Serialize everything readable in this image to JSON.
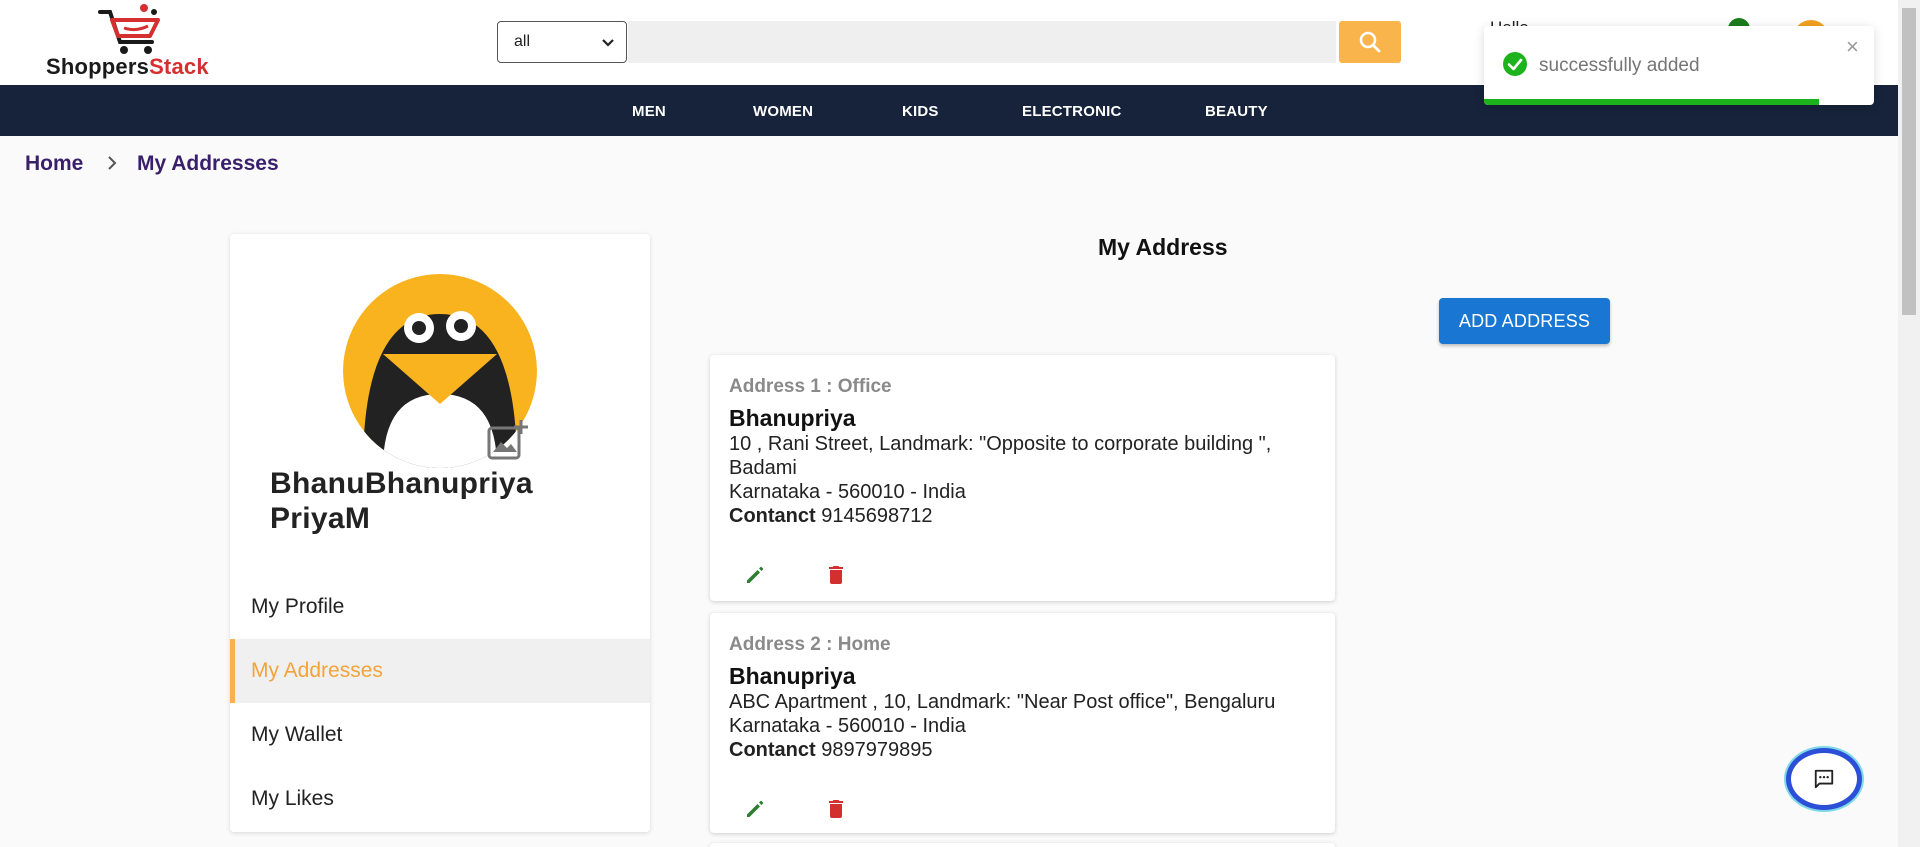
{
  "header": {
    "logo": {
      "part1": "Shoppers",
      "part2": "Stack"
    },
    "search": {
      "category_selected": "all",
      "placeholder": ""
    },
    "greeting": "Hello"
  },
  "nav": {
    "items": [
      "MEN",
      "WOMEN",
      "KIDS",
      "ELECTRONIC",
      "BEAUTY"
    ]
  },
  "toast": {
    "message": "successfully added",
    "progress": 0.86
  },
  "breadcrumb": {
    "home": "Home",
    "current": "My Addresses"
  },
  "sidebar": {
    "user_name": "BhanuBhanupriya PriyaM",
    "items": [
      "My Profile",
      "My Addresses",
      "My Wallet",
      "My Likes"
    ],
    "active": "My Addresses"
  },
  "main": {
    "title": "My Address",
    "add_button": "ADD ADDRESS",
    "addresses": [
      {
        "heading": "Address 1 :   Office",
        "name": "Bhanupriya",
        "line1": "10 , Rani Street, Landmark: \"Opposite to corporate building \", Badami",
        "line2": "Karnataka - 560010 - India",
        "contact_label": "Contanct",
        "contact": "9145698712"
      },
      {
        "heading": "Address 2 :   Home",
        "name": "Bhanupriya",
        "line1": "ABC Apartment , 10, Landmark: \"Near Post office\", Bengaluru",
        "line2": "Karnataka - 560010 - India",
        "contact_label": "Contanct",
        "contact": "9897979895"
      }
    ]
  },
  "colors": {
    "navbar": "#16233a",
    "accent": "#f6b24d",
    "primary_button": "#1976d2",
    "success": "#1db31d",
    "delete": "#d32f2f",
    "edit": "#2e7d32"
  }
}
